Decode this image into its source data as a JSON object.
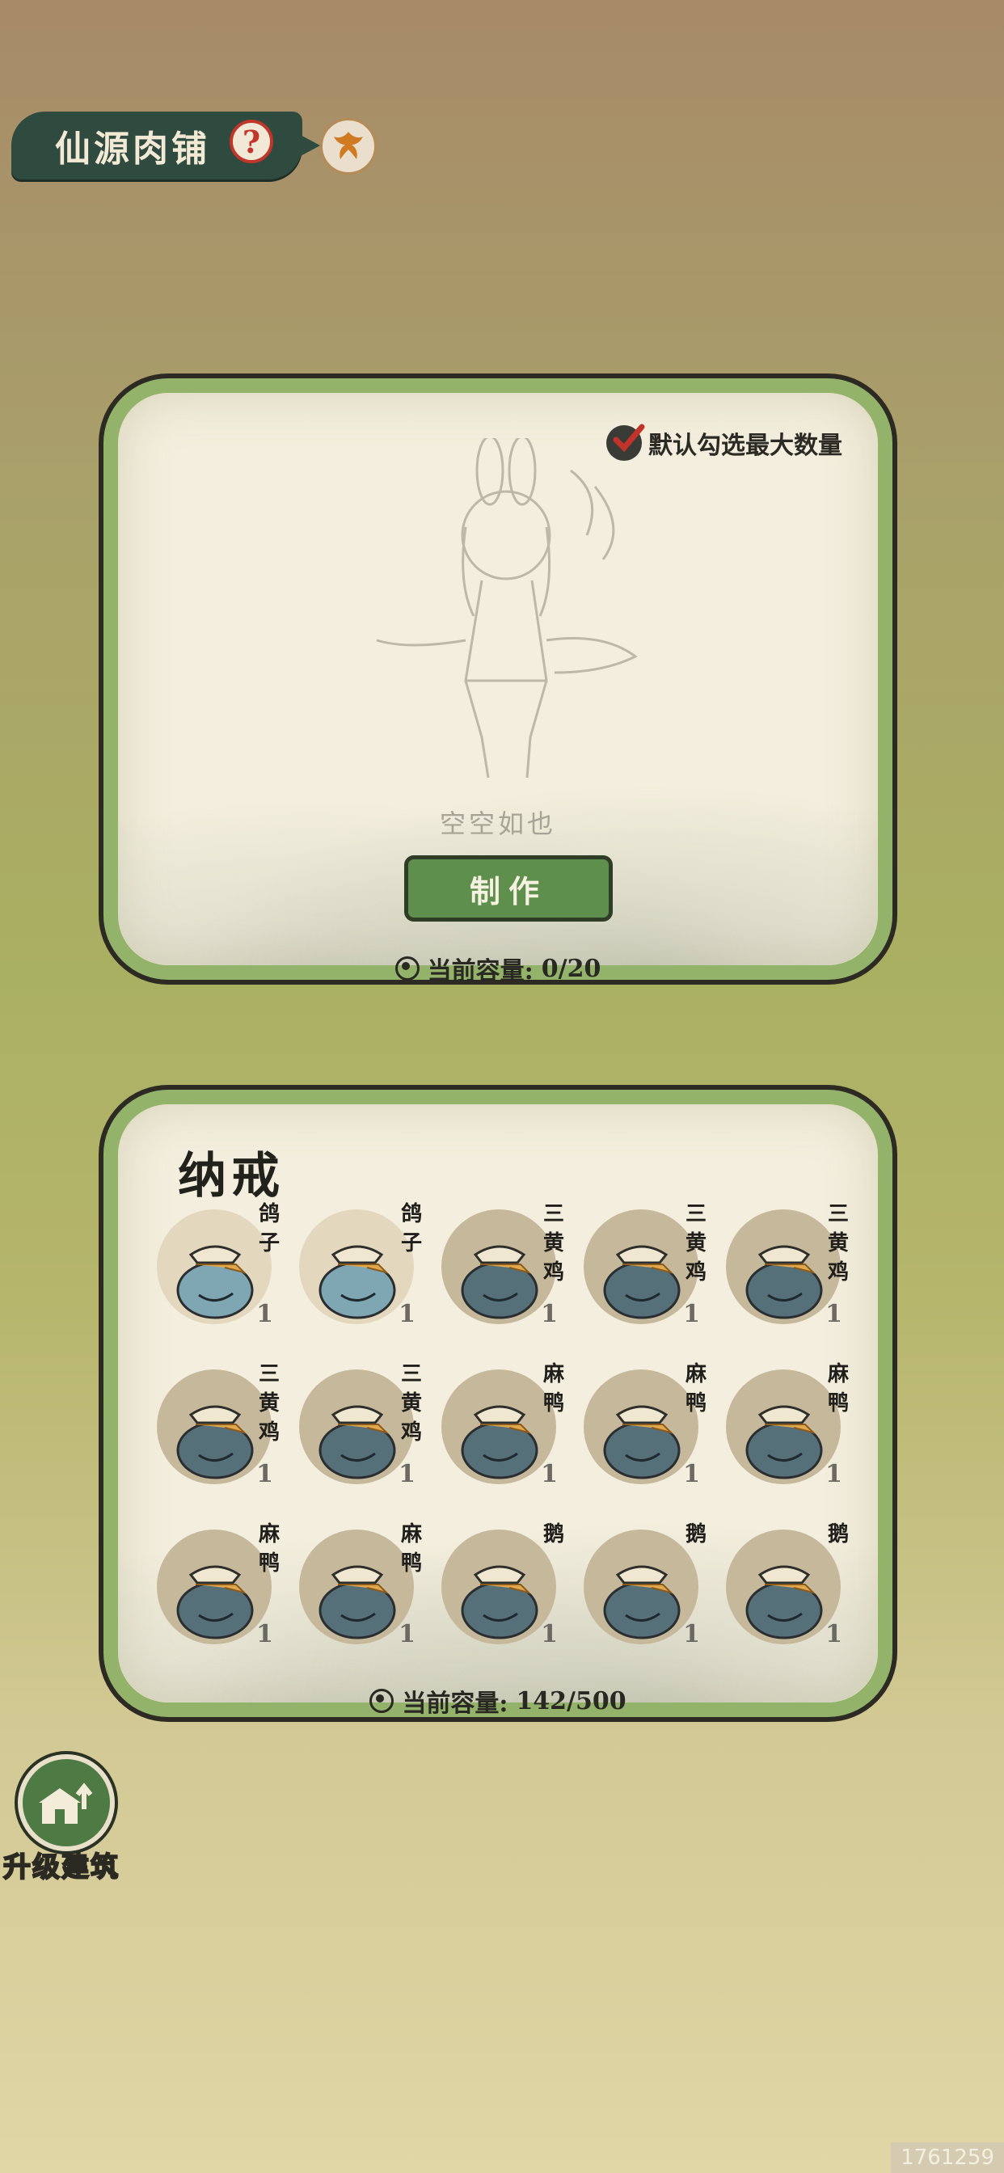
{
  "header": {
    "title": "仙源肉铺",
    "help_icon": "?",
    "phoenix_icon": "phoenix-icon"
  },
  "craft": {
    "max_toggle_label": "默认勾选最大数量",
    "empty_text": "空空如也",
    "make_button": "制作",
    "capacity_label": "当前容量:",
    "capacity_value": "0/20"
  },
  "storage": {
    "title": "纳戒",
    "capacity_label": "当前容量:",
    "capacity_value": "142/500",
    "items": [
      {
        "name": "鸽子",
        "qty": "1",
        "lit": true
      },
      {
        "name": "鸽子",
        "qty": "1",
        "lit": true
      },
      {
        "name": "三黄鸡",
        "qty": "1",
        "lit": false
      },
      {
        "name": "三黄鸡",
        "qty": "1",
        "lit": false
      },
      {
        "name": "三黄鸡",
        "qty": "1",
        "lit": false
      },
      {
        "name": "三黄鸡",
        "qty": "1",
        "lit": false
      },
      {
        "name": "三黄鸡",
        "qty": "1",
        "lit": false
      },
      {
        "name": "麻鸭",
        "qty": "1",
        "lit": false
      },
      {
        "name": "麻鸭",
        "qty": "1",
        "lit": false
      },
      {
        "name": "麻鸭",
        "qty": "1",
        "lit": false
      },
      {
        "name": "麻鸭",
        "qty": "1",
        "lit": false
      },
      {
        "name": "麻鸭",
        "qty": "1",
        "lit": false
      },
      {
        "name": "鹅",
        "qty": "1",
        "lit": false
      },
      {
        "name": "鹅",
        "qty": "1",
        "lit": false
      },
      {
        "name": "鹅",
        "qty": "1",
        "lit": false
      }
    ]
  },
  "upgrade": {
    "label": "升级建筑"
  },
  "footer": {
    "build_id": "1761259"
  },
  "colors": {
    "panel_border": "#93b36a",
    "button_green": "#5e8f4c",
    "title_bg": "#2f4a3f"
  }
}
